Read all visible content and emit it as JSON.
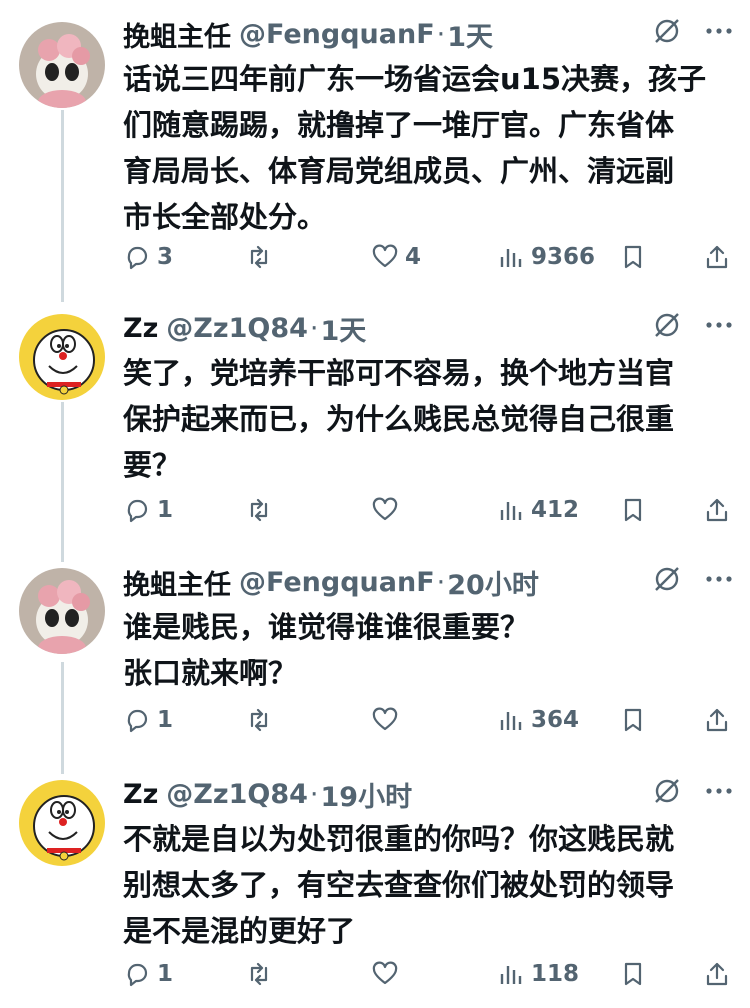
{
  "tweets": [
    {
      "name": "挽蛆主任",
      "handle": "@FengquanF",
      "time": "1天",
      "text": "话说三四年前广东一场省运会u15决赛，孩子\n们随意踢踢，就撸掉了一堆厅官。广东省体\n育局局长、体育局党组成员、广州、清远副\n市长全部处分。",
      "replies": "3",
      "retweets": "",
      "likes": "4",
      "views": "9366",
      "avatar": "panda-avatar"
    },
    {
      "name": "Zz",
      "handle": "@Zz1Q84",
      "time": "1天",
      "text": "笑了，党培养干部可不容易，换个地方当官\n保护起来而已，为什么贱民总觉得自己很重\n要？",
      "replies": "1",
      "retweets": "",
      "likes": "",
      "views": "412",
      "avatar": "doraemon-avatar"
    },
    {
      "name": "挽蛆主任",
      "handle": "@FengquanF",
      "time": "20小时",
      "text": "谁是贱民，谁觉得谁谁很重要？\n张口就来啊？",
      "replies": "1",
      "retweets": "",
      "likes": "",
      "views": "364",
      "avatar": "panda-avatar"
    },
    {
      "name": "Zz",
      "handle": "@Zz1Q84",
      "time": "19小时",
      "text": "不就是自以为处罚很重的你吗？你这贱民就\n别想太多了，有空去查查你们被处罚的领导\n是不是混的更好了",
      "replies": "1",
      "retweets": "",
      "likes": "",
      "views": "118",
      "avatar": "doraemon-avatar"
    }
  ],
  "separator": "·",
  "colors": {
    "text": "#0f1419",
    "secondary": "#536471",
    "thread_line": "#cfd9de"
  }
}
